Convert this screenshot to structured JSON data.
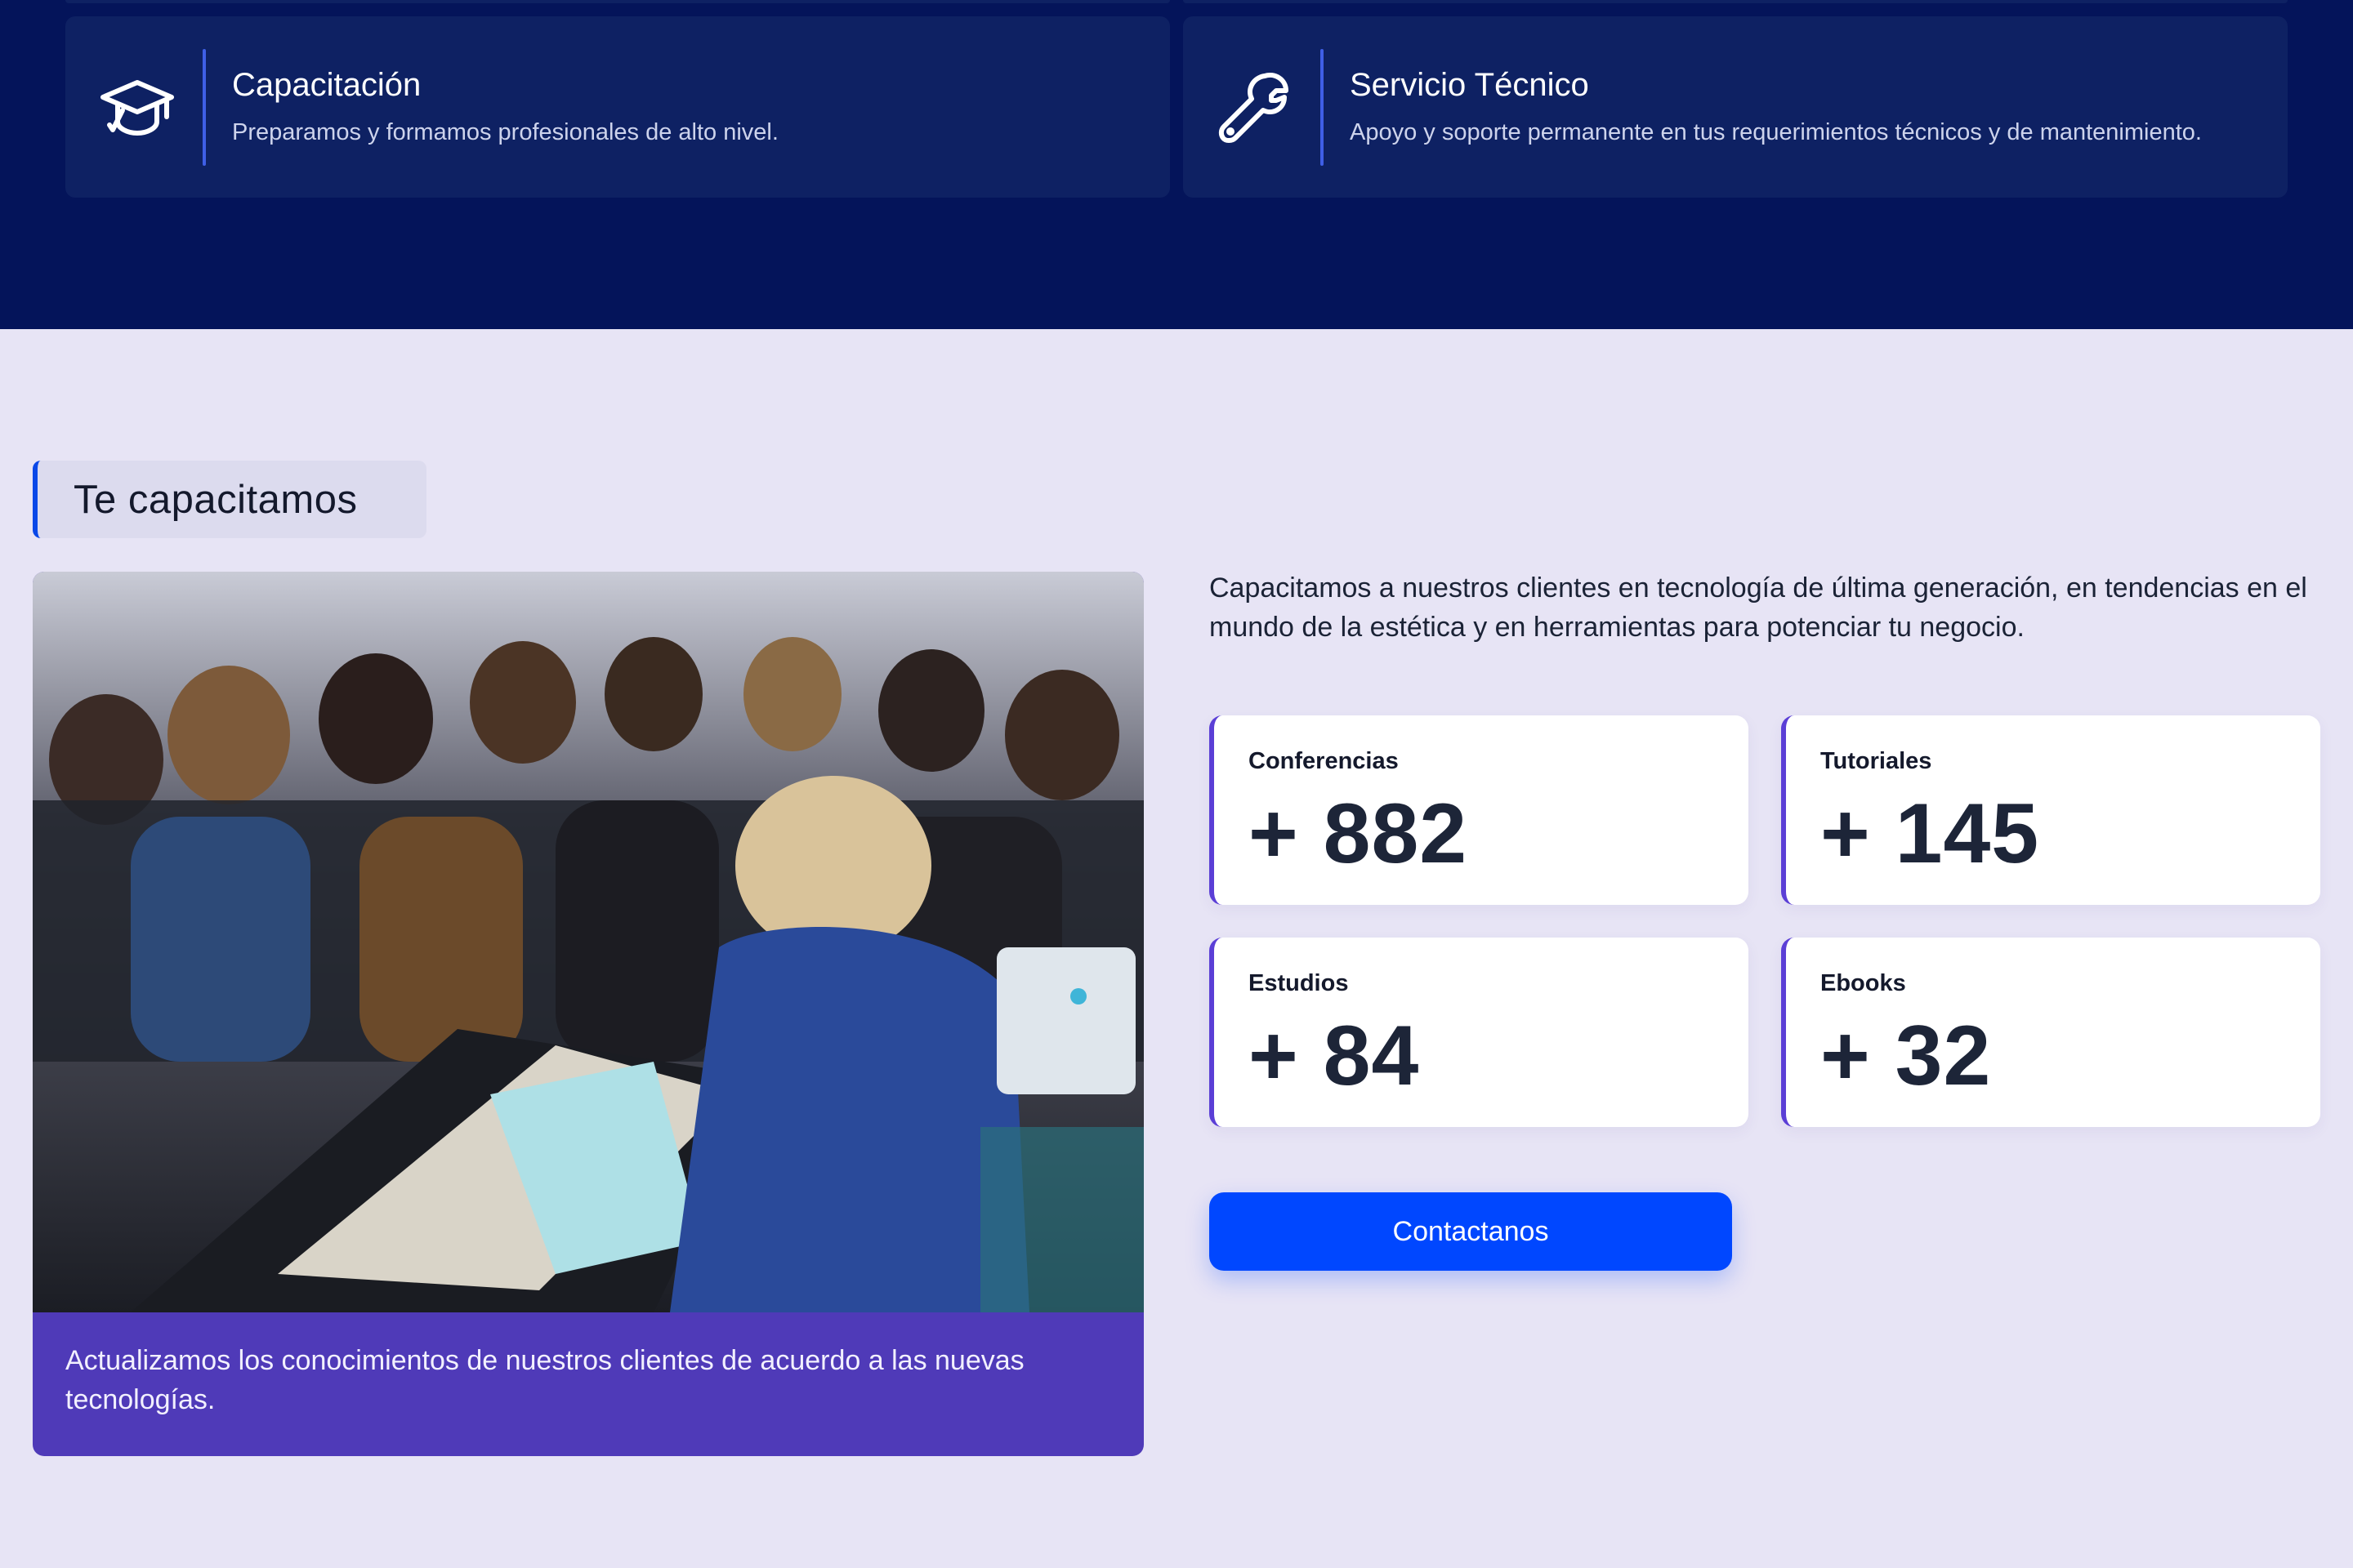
{
  "services": [
    {
      "title": "Capacitación",
      "description": "Preparamos y formamos profesionales de alto nivel.",
      "icon": "graduation-cap-icon"
    },
    {
      "title": "Servicio Técnico",
      "description": "Apoyo y soporte permanente en tus requerimientos técnicos y de mantenimiento.",
      "icon": "wrench-icon"
    }
  ],
  "section": {
    "heading": "Te capacitamos",
    "intro": "Capacitamos a nuestros clientes en tecnología de última generación, en tendencias en el mundo de la estética y en herramientas para potenciar tu negocio.",
    "photo_caption": "Actualizamos los conocimientos de nuestros clientes de acuerdo a las nuevas tecnologías."
  },
  "stats": [
    {
      "label": "Conferencias",
      "value": "+ 882"
    },
    {
      "label": "Tutoriales",
      "value": "+ 145"
    },
    {
      "label": "Estudios",
      "value": "+ 84"
    },
    {
      "label": "Ebooks",
      "value": "+ 32"
    }
  ],
  "cta": {
    "label": "Contactanos"
  },
  "colors": {
    "dark_band": "#04145a",
    "card_dark": "#0e2163",
    "accent_blue": "#0047ff",
    "accent_purple": "#5b3fd6",
    "caption_bg": "#4f3ab8",
    "page_bg": "#e7e4f5"
  }
}
